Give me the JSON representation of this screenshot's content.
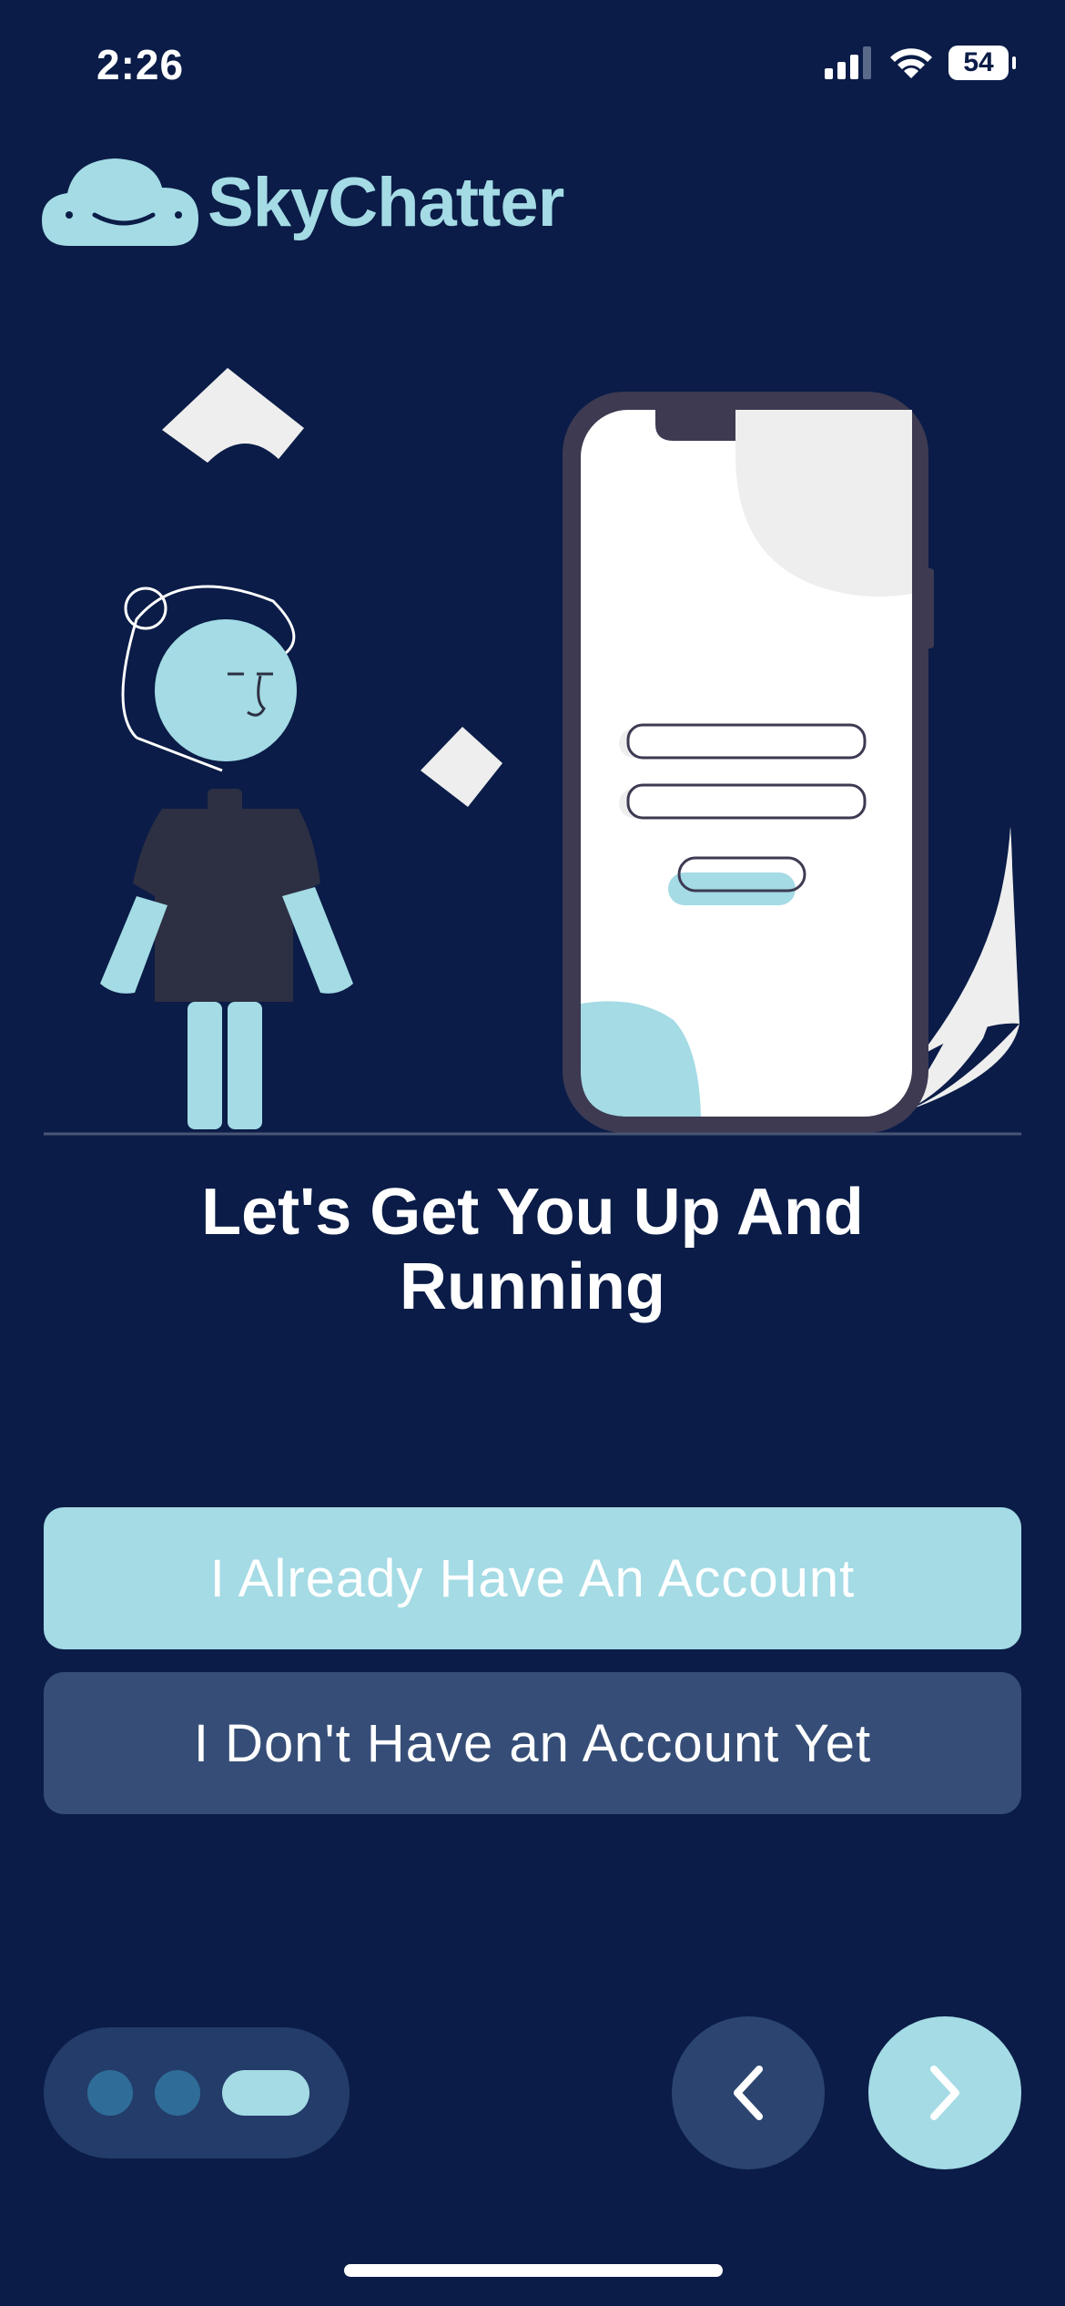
{
  "status_bar": {
    "time": "2:26",
    "battery": "54",
    "icons": [
      "signal-icon",
      "wifi-icon",
      "battery-icon"
    ]
  },
  "brand": {
    "name": "SkyChatter",
    "logo_icon": "cloud-smile-icon",
    "accent_color": "#a4dbe5"
  },
  "headline": "Let's Get You Up And Running",
  "buttons": {
    "have_account": "I Already Have An Account",
    "no_account": "I Don't Have an Account Yet"
  },
  "pager": {
    "total_pages": 3,
    "current_page": 3
  },
  "nav": {
    "prev_icon": "chevron-left-icon",
    "next_icon": "chevron-right-icon"
  },
  "colors": {
    "background": "#0a1c47",
    "primary_button": "#a4dbe5",
    "secondary_button": "#364e77"
  }
}
